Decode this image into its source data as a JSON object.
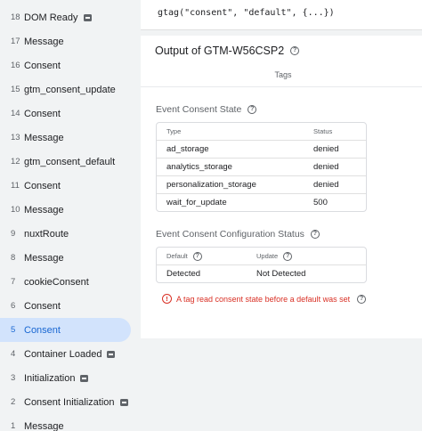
{
  "sidebar": {
    "events": [
      {
        "num": "18",
        "name": "DOM Ready",
        "tag_icon": true,
        "selected": false
      },
      {
        "num": "17",
        "name": "Message",
        "tag_icon": false,
        "selected": false
      },
      {
        "num": "16",
        "name": "Consent",
        "tag_icon": false,
        "selected": false
      },
      {
        "num": "15",
        "name": "gtm_consent_update",
        "tag_icon": false,
        "selected": false
      },
      {
        "num": "14",
        "name": "Consent",
        "tag_icon": false,
        "selected": false
      },
      {
        "num": "13",
        "name": "Message",
        "tag_icon": false,
        "selected": false
      },
      {
        "num": "12",
        "name": "gtm_consent_default",
        "tag_icon": false,
        "selected": false
      },
      {
        "num": "11",
        "name": "Consent",
        "tag_icon": false,
        "selected": false
      },
      {
        "num": "10",
        "name": "Message",
        "tag_icon": false,
        "selected": false
      },
      {
        "num": "9",
        "name": "nuxtRoute",
        "tag_icon": false,
        "selected": false
      },
      {
        "num": "8",
        "name": "Message",
        "tag_icon": false,
        "selected": false
      },
      {
        "num": "7",
        "name": "cookieConsent",
        "tag_icon": false,
        "selected": false
      },
      {
        "num": "6",
        "name": "Consent",
        "tag_icon": false,
        "selected": false
      },
      {
        "num": "5",
        "name": "Consent",
        "tag_icon": false,
        "selected": true
      },
      {
        "num": "4",
        "name": "Container Loaded",
        "tag_icon": true,
        "selected": false
      },
      {
        "num": "3",
        "name": "Initialization",
        "tag_icon": true,
        "selected": false
      },
      {
        "num": "2",
        "name": "Consent Initialization",
        "tag_icon": true,
        "selected": false
      },
      {
        "num": "1",
        "name": "Message",
        "tag_icon": false,
        "selected": false
      }
    ]
  },
  "code": {
    "snippet": "gtag(\"consent\", \"default\", {...})"
  },
  "output": {
    "title": "Output of GTM-W56CSP2",
    "tab_label": "Tags",
    "event_consent_state": {
      "title": "Event Consent State",
      "columns": [
        "Type",
        "Status"
      ],
      "rows": [
        {
          "type": "ad_storage",
          "status": "denied"
        },
        {
          "type": "analytics_storage",
          "status": "denied"
        },
        {
          "type": "personalization_storage",
          "status": "denied"
        },
        {
          "type": "wait_for_update",
          "status": "500"
        }
      ]
    },
    "config_status": {
      "title": "Event Consent Configuration Status",
      "columns": [
        "Default",
        "Update"
      ],
      "row": {
        "default": "Detected",
        "update": "Not Detected"
      }
    },
    "warning": "A tag read consent state before a default was set"
  },
  "colors": {
    "selected_bg": "#d2e3fc",
    "selected_text": "#1967d2",
    "error": "#d93025"
  },
  "icons": {
    "help": "help-circle-icon",
    "error": "error-circle-icon",
    "tag": "tag-icon"
  }
}
